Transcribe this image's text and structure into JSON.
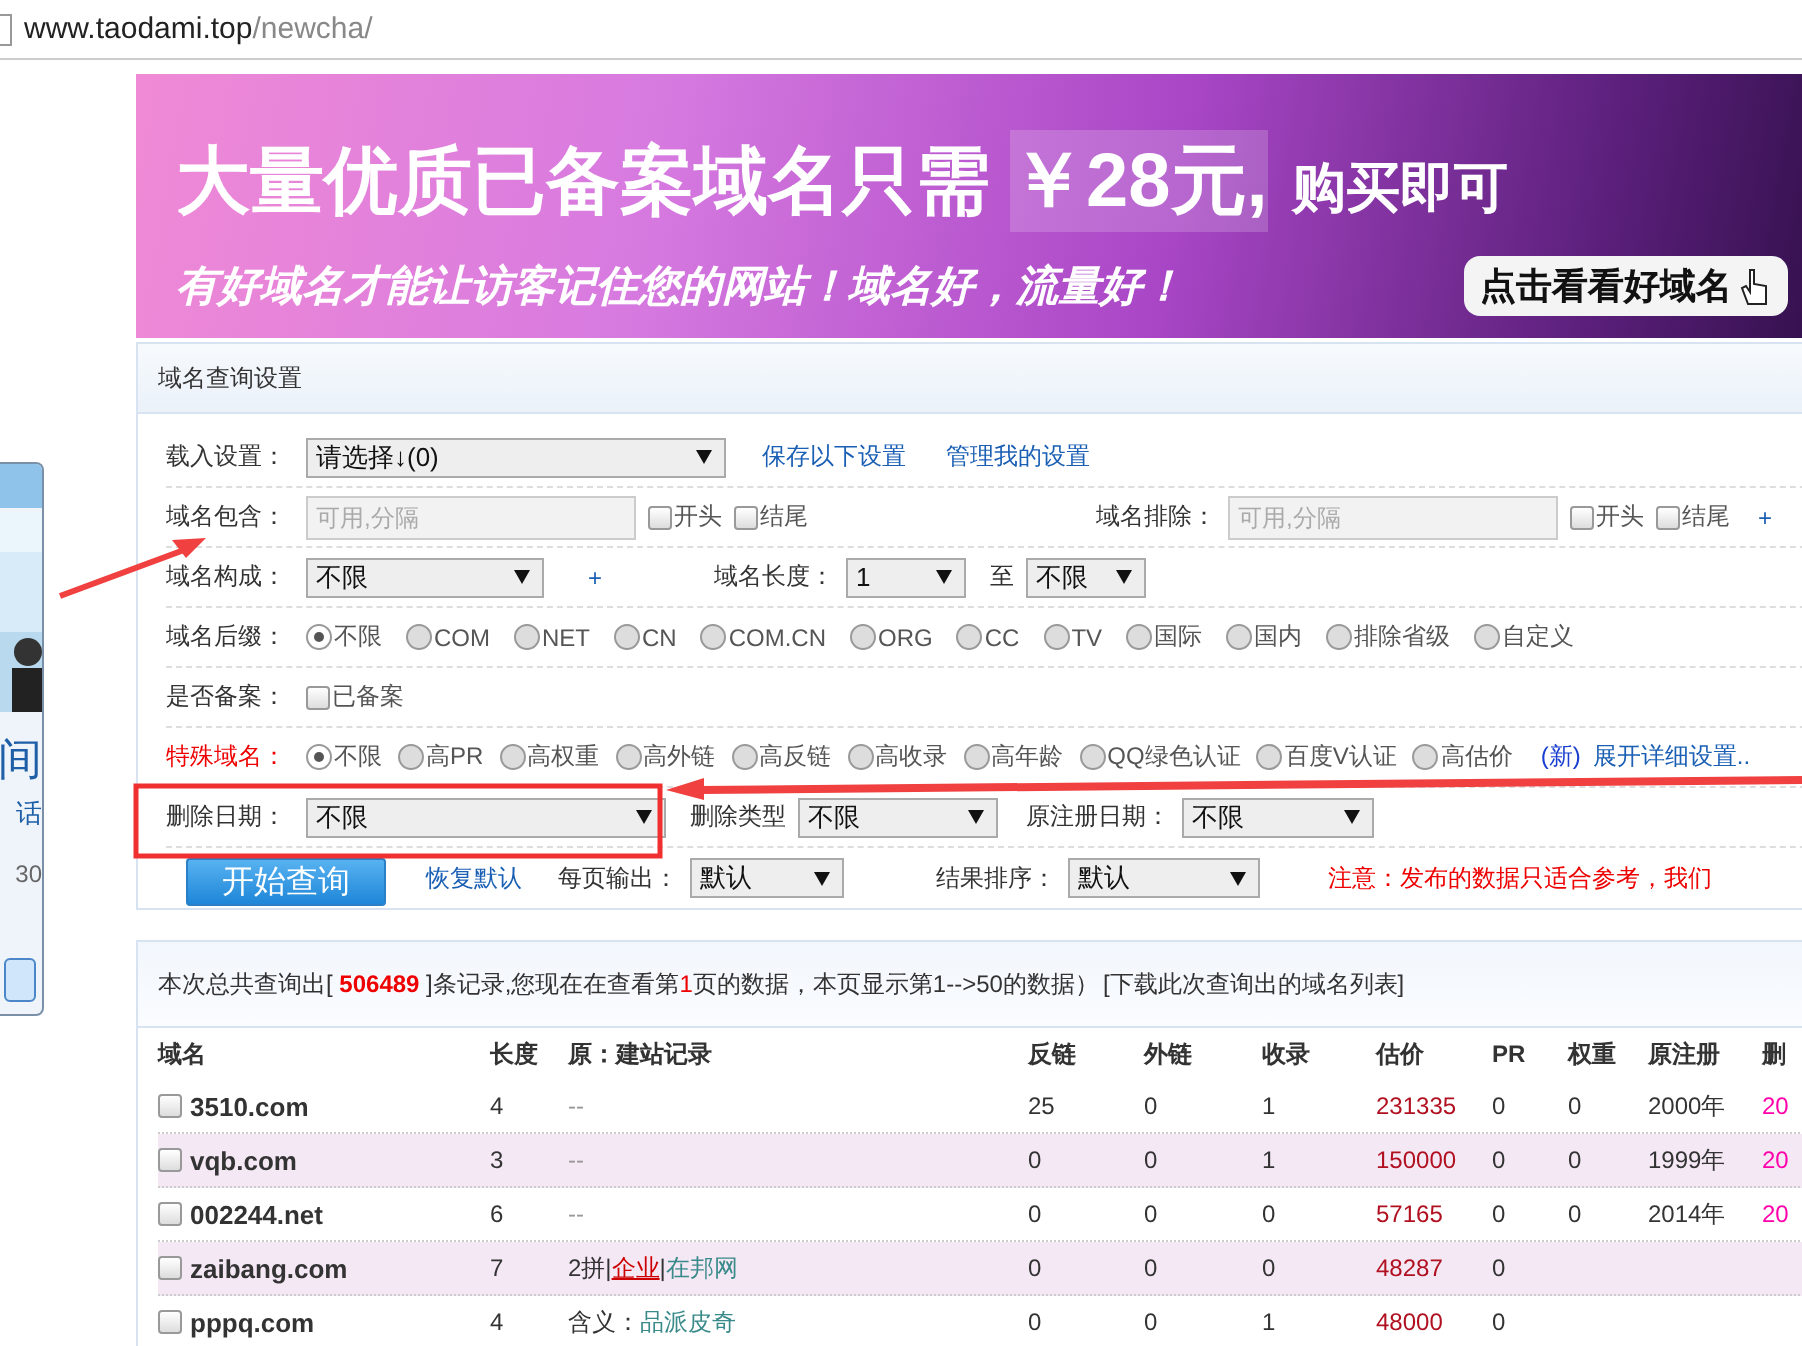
{
  "address_bar": {
    "host": "www.taodami.top",
    "path": "/newcha/"
  },
  "banner": {
    "headline": "大量优质已备案域名只需",
    "price": "￥28元,",
    "tail": "购买即可",
    "slogan": "有好域名才能让访客记住您的网站！域名好，流量好！",
    "button": "点击看看好域名"
  },
  "side_panel": {
    "texts": [
      "间",
      "话",
      "30"
    ]
  },
  "form": {
    "title": "域名查询设置",
    "rows": [
      {
        "items": [
          {
            "kind": "label",
            "text": "载入设置："
          },
          {
            "kind": "select",
            "value": "请选择↓(0)"
          },
          {
            "kind": "link",
            "text": "保存以下设置"
          },
          {
            "kind": "link",
            "text": "管理我的设置"
          }
        ]
      },
      {
        "items": [
          {
            "kind": "label",
            "text": "域名包含："
          },
          {
            "kind": "input",
            "placeholder": "可用,分隔"
          },
          {
            "kind": "checkbox",
            "label": "开头",
            "checked": false
          },
          {
            "kind": "checkbox",
            "label": "结尾",
            "checked": false
          },
          {
            "kind": "label",
            "text": "域名排除："
          },
          {
            "kind": "input",
            "placeholder": "可用,分隔"
          },
          {
            "kind": "checkbox",
            "label": "开头",
            "checked": false
          },
          {
            "kind": "checkbox",
            "label": "结尾",
            "checked": false
          },
          {
            "kind": "plus",
            "text": "+"
          }
        ]
      },
      {
        "items": [
          {
            "kind": "label",
            "text": "域名构成："
          },
          {
            "kind": "select",
            "value": "不限"
          },
          {
            "kind": "plus",
            "text": "+"
          },
          {
            "kind": "label",
            "text": "域名长度："
          },
          {
            "kind": "select",
            "value": "1"
          },
          {
            "kind": "label",
            "text": "至"
          },
          {
            "kind": "select",
            "value": "不限"
          }
        ]
      },
      {
        "items": [
          {
            "kind": "label",
            "text": "域名后缀："
          },
          {
            "kind": "radio",
            "label": "不限",
            "selected": true
          },
          {
            "kind": "radio",
            "label": "COM",
            "selected": false
          },
          {
            "kind": "radio",
            "label": "NET",
            "selected": false
          },
          {
            "kind": "radio",
            "label": "CN",
            "selected": false
          },
          {
            "kind": "radio",
            "label": "COM.CN",
            "selected": false
          },
          {
            "kind": "radio",
            "label": "ORG",
            "selected": false
          },
          {
            "kind": "radio",
            "label": "CC",
            "selected": false
          },
          {
            "kind": "radio",
            "label": "TV",
            "selected": false
          },
          {
            "kind": "radio",
            "label": "国际",
            "selected": false
          },
          {
            "kind": "radio",
            "label": "国内",
            "selected": false
          },
          {
            "kind": "radio",
            "label": "排除省级",
            "selected": false
          },
          {
            "kind": "radio",
            "label": "自定义",
            "selected": false
          }
        ]
      },
      {
        "items": [
          {
            "kind": "label",
            "text": "是否备案："
          },
          {
            "kind": "checkbox",
            "label": "已备案",
            "checked": false
          }
        ]
      },
      {
        "items": [
          {
            "kind": "label",
            "text": "特殊域名：",
            "emphasis": true
          },
          {
            "kind": "radio",
            "label": "不限",
            "selected": true
          },
          {
            "kind": "radio",
            "label": "高PR",
            "selected": false
          },
          {
            "kind": "radio",
            "label": "高权重",
            "selected": false
          },
          {
            "kind": "radio",
            "label": "高外链",
            "selected": false
          },
          {
            "kind": "radio",
            "label": "高反链",
            "selected": false
          },
          {
            "kind": "radio",
            "label": "高收录",
            "selected": false
          },
          {
            "kind": "radio",
            "label": "高年龄",
            "selected": false
          },
          {
            "kind": "radio",
            "label": "QQ绿色认证",
            "selected": false
          },
          {
            "kind": "radio",
            "label": "百度V认证",
            "selected": false
          },
          {
            "kind": "radio",
            "label": "高估价",
            "selected": false
          },
          {
            "kind": "tag",
            "text": "(新)"
          },
          {
            "kind": "link",
            "text": "展开详细设置.."
          }
        ]
      },
      {
        "items": [
          {
            "kind": "label",
            "text": "删除日期："
          },
          {
            "kind": "select",
            "value": "不限"
          },
          {
            "kind": "label",
            "text": "删除类型"
          },
          {
            "kind": "select",
            "value": "不限"
          },
          {
            "kind": "label",
            "text": "原注册日期："
          },
          {
            "kind": "select",
            "value": "不限"
          }
        ]
      },
      {
        "items": [
          {
            "kind": "button",
            "text": "开始查询"
          },
          {
            "kind": "link",
            "text": "恢复默认"
          },
          {
            "kind": "label",
            "text": "每页输出："
          },
          {
            "kind": "select",
            "value": "默认"
          },
          {
            "kind": "label",
            "text": "结果排序："
          },
          {
            "kind": "select",
            "value": "默认"
          },
          {
            "kind": "note",
            "text": "注意：发布的数据只适合参考，我们"
          }
        ]
      }
    ]
  },
  "results": {
    "summary": [
      {
        "text": "本次总共查询出[ ",
        "emphasis": false
      },
      {
        "text": "506489",
        "emphasis": true
      },
      {
        "text": " ]条记录,您现在在查看第",
        "emphasis": false
      },
      {
        "text": "1",
        "emphasis": true
      },
      {
        "text": "页的数据，本页显示第1-->50的数据）",
        "emphasis": false
      }
    ],
    "download_link": "[下载此次查询出的域名列表]",
    "columns": [
      "域名",
      "长度",
      "原：建站记录",
      "反链",
      "外链",
      "收录",
      "估价",
      "PR",
      "权重",
      "原注册",
      "删"
    ],
    "rows": [
      {
        "checked": false,
        "cells": [
          "3510.com",
          "4",
          [
            {
              "kind": "dash",
              "text": "--"
            }
          ],
          "25",
          "0",
          "1",
          "231335",
          "0",
          "0",
          "2000年",
          "20"
        ]
      },
      {
        "checked": false,
        "cells": [
          "vqb.com",
          "3",
          [
            {
              "kind": "dash",
              "text": "--"
            }
          ],
          "0",
          "0",
          "1",
          "150000",
          "0",
          "0",
          "1999年",
          "20"
        ]
      },
      {
        "checked": false,
        "cells": [
          "002244.net",
          "6",
          [
            {
              "kind": "dash",
              "text": "--"
            }
          ],
          "0",
          "0",
          "0",
          "57165",
          "0",
          "0",
          "2014年",
          "20"
        ]
      },
      {
        "checked": false,
        "cells": [
          "zaibang.com",
          "7",
          [
            {
              "kind": "plain",
              "text": "2拼|"
            },
            {
              "kind": "link",
              "text": "企业"
            },
            {
              "kind": "plain",
              "text": "|"
            },
            {
              "kind": "term",
              "text": "在邦网"
            }
          ],
          "0",
          "0",
          "0",
          "48287",
          "0"
        ]
      },
      {
        "checked": false,
        "cells": [
          "pppq.com",
          "4",
          [
            {
              "kind": "plain",
              "text": "含义："
            },
            {
              "kind": "term",
              "text": "品派皮奇"
            }
          ],
          "0",
          "0",
          "1",
          "48000",
          "0"
        ]
      }
    ]
  }
}
